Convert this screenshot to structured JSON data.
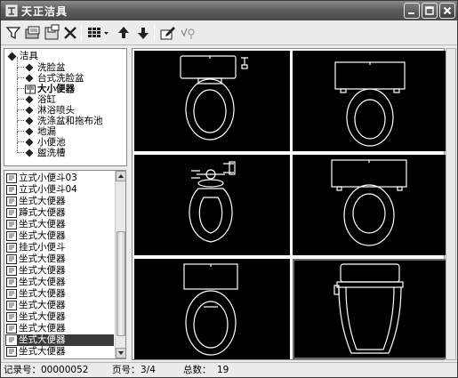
{
  "window": {
    "title": "天正洁具"
  },
  "toolbar": {
    "items": [
      "filter-icon",
      "open-library-icon",
      "save-icon",
      "delete-icon",
      "view-grid-icon",
      "move-up-icon",
      "move-down-icon",
      "edit-icon",
      "options-icon"
    ]
  },
  "tree": {
    "root": "洁具",
    "children": [
      {
        "label": "洗脸盆"
      },
      {
        "label": "台式洗脸盆"
      },
      {
        "label": "大小便器",
        "selected": true
      },
      {
        "label": "浴缸"
      },
      {
        "label": "淋浴喷头"
      },
      {
        "label": "洗涤盆和拖布池"
      },
      {
        "label": "地漏"
      },
      {
        "label": "小便池"
      },
      {
        "label": "盥洗槽"
      }
    ]
  },
  "list": {
    "items": [
      {
        "label": "立式小便斗03"
      },
      {
        "label": "立式小便斗04"
      },
      {
        "label": "坐式大便器"
      },
      {
        "label": "蹲式大便器"
      },
      {
        "label": "坐式大便器"
      },
      {
        "label": "坐式大便器"
      },
      {
        "label": "挂式小便斗"
      },
      {
        "label": "坐式大便器"
      },
      {
        "label": "坐式大便器"
      },
      {
        "label": "坐式大便器"
      },
      {
        "label": "坐式大便器"
      },
      {
        "label": "坐式大便器"
      },
      {
        "label": "坐式大便器"
      },
      {
        "label": "坐式大便器"
      },
      {
        "label": "坐式大便器",
        "active": true
      },
      {
        "label": "坐式大便器"
      }
    ]
  },
  "preview": {
    "cells": 6,
    "selected_index": 5,
    "background": "#000000",
    "line_color": "#ffffff"
  },
  "status": {
    "record_label": "记录号：",
    "record_value": "00000052",
    "page_label": "页号：",
    "page_value": "3/4",
    "total_label": "总数：",
    "total_value": "19"
  }
}
